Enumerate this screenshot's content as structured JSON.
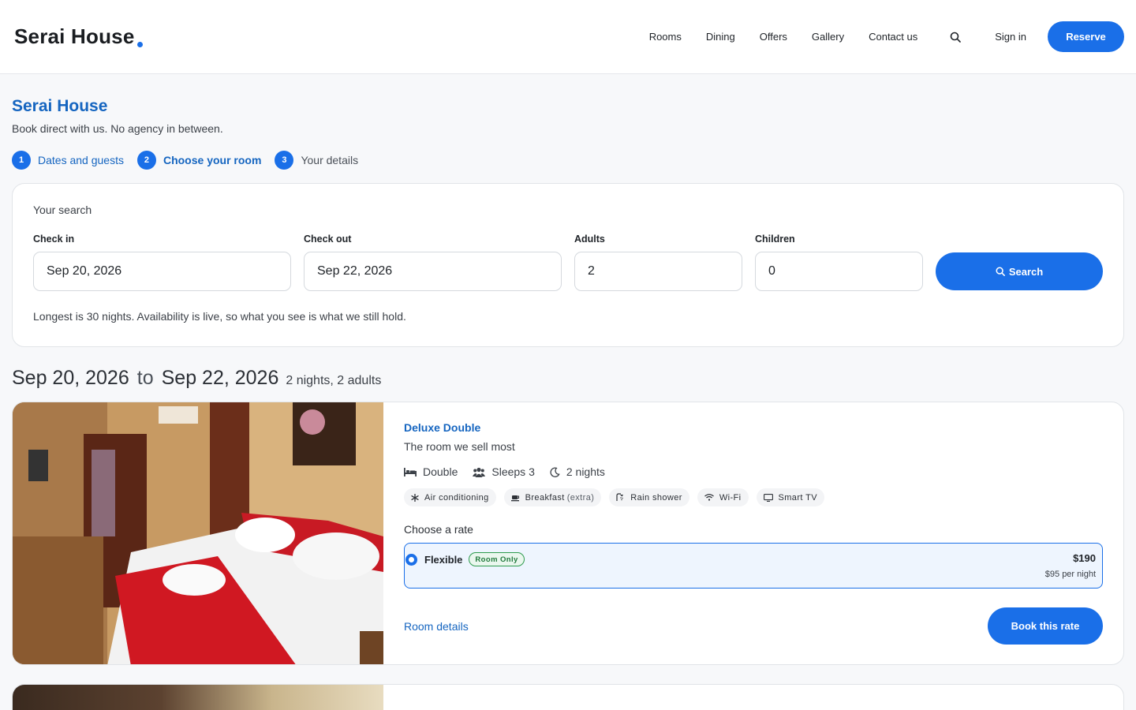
{
  "header": {
    "logo": "Serai House",
    "nav": [
      "Rooms",
      "Dining",
      "Offers",
      "Gallery",
      "Contact us"
    ],
    "sign_in": "Sign in",
    "reserve": "Reserve"
  },
  "page": {
    "title": "Serai House",
    "tagline": "Book direct with us. No agency in between.",
    "steps": [
      {
        "num": "1",
        "label": "Dates and guests"
      },
      {
        "num": "2",
        "label": "Choose your room"
      },
      {
        "num": "3",
        "label": "Your details"
      }
    ]
  },
  "search": {
    "title": "Your search",
    "check_in_label": "Check in",
    "check_in_value": "Sep 20, 2026",
    "check_out_label": "Check out",
    "check_out_value": "Sep 22, 2026",
    "adults_label": "Adults",
    "adults_value": "2",
    "children_label": "Children",
    "children_value": "0",
    "button": "Search",
    "note": "Longest is 30 nights. Availability is live, so what you see is what we still hold."
  },
  "results": {
    "from": "Sep 20, 2026",
    "to_word": "to",
    "to": "Sep 22, 2026",
    "summary": "2 nights, 2 adults"
  },
  "room": {
    "name": "Deluxe Double",
    "subtitle": "The room we sell most",
    "bed": "Double",
    "sleeps": "Sleeps 3",
    "nights": "2 nights",
    "amenities": [
      {
        "label": "Air conditioning",
        "extra": ""
      },
      {
        "label": "Breakfast",
        "extra": "(extra)"
      },
      {
        "label": "Rain shower",
        "extra": ""
      },
      {
        "label": "Wi-Fi",
        "extra": ""
      },
      {
        "label": "Smart TV",
        "extra": ""
      }
    ],
    "rate_title": "Choose a rate",
    "rate_name": "Flexible",
    "rate_badge": "Room Only",
    "rate_total": "$190",
    "rate_per_night": "$95 per night",
    "details_link": "Room details",
    "book_button": "Book this rate"
  },
  "colors": {
    "accent": "#1a6fe8",
    "link": "#1565c0",
    "badge_green": "#2e9b4e"
  }
}
